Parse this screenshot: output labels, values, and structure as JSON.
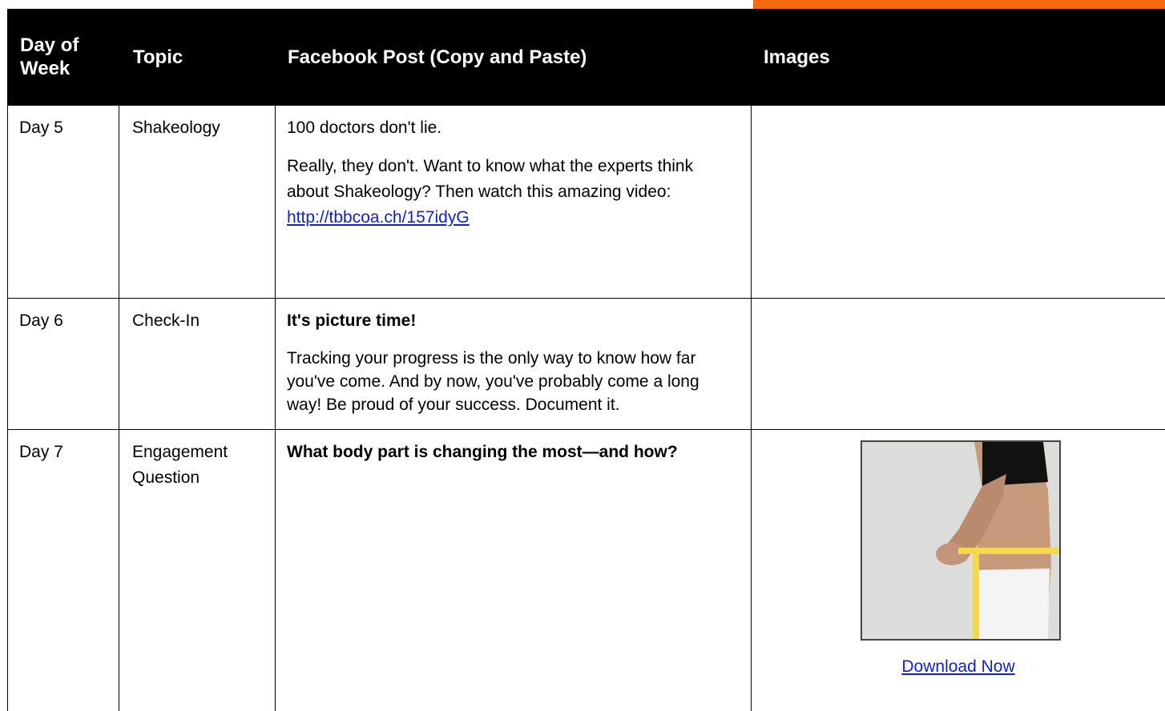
{
  "header": {
    "col_day": "Day of Week",
    "col_topic": "Topic",
    "col_post": "Facebook Post (Copy and Paste)",
    "col_images": "Images"
  },
  "rows": [
    {
      "day": "Day 5",
      "topic": "Shakeology",
      "post_p1": "100 doctors don't lie.",
      "post_p2": "Really, they don't. Want to know what the experts think about Shakeology? Then watch this amazing video: ",
      "post_link": "http://tbbcoa.ch/157idyG"
    },
    {
      "day": "Day 6",
      "topic": "Check-In",
      "post_title": "It's picture time!",
      "post_p2": "Tracking your progress is the only way to know how far you've come. And by now, you've probably come a long way! Be proud of your success. Document it."
    },
    {
      "day": "Day 7",
      "topic": "Engagement Question",
      "post_title": "What body part is changing the most—and how?",
      "image_link": "Download Now"
    }
  ],
  "colors": {
    "accent": "#f26b0f",
    "header_bg": "#000000",
    "link": "#1122cc"
  }
}
